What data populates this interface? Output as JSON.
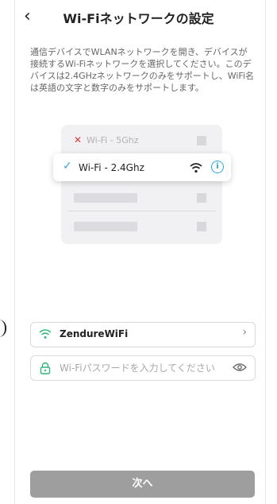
{
  "header": {
    "title": "Wi-Fiネットワークの設定",
    "back_icon": "chevron-left-icon"
  },
  "description": "通信デバイスでWLANネットワークを開き、デバイスが接続するWi-Fiネットワークを選択してください。このデバイスは2.4GHzネットワークのみをサポートし、WiFi名は英語の文字と数字のみをサポートします。",
  "illustration": {
    "item_5g": {
      "label": "Wi-Fi - 5Ghz",
      "mark": "✕"
    },
    "item_24g": {
      "label": "Wi-Fi - 2.4Ghz",
      "mark": "✓"
    }
  },
  "wifi_field": {
    "value": "ZendureWiFi"
  },
  "password_field": {
    "placeholder": "Wi-Fiパスワードを入力してください",
    "value": ""
  },
  "next_button": {
    "label": "次へ"
  },
  "colors": {
    "accent": "#2aa6e0",
    "error": "#e53935",
    "button_disabled": "#9e9e9e",
    "wifi_icon": "#2fb67a"
  }
}
